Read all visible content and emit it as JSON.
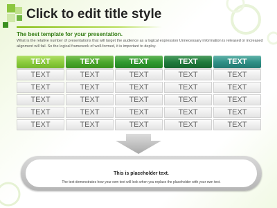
{
  "slide": {
    "title": "Click to edit title style",
    "subtitle": "The best template for your presentation.",
    "body": "What is the relative number of presentations that will target the audience as a logical expression Unnecessary information is released or increased alignment will fail. So the logical framework of well-formed, it is important to deploy."
  },
  "table": {
    "headers": [
      "TEXT",
      "TEXT",
      "TEXT",
      "TEXT",
      "TEXT"
    ],
    "rows": [
      [
        "TEXT",
        "TEXT",
        "TEXT",
        "TEXT",
        "TEXT"
      ],
      [
        "TEXT",
        "TEXT",
        "TEXT",
        "TEXT",
        "TEXT"
      ],
      [
        "TEXT",
        "TEXT",
        "TEXT",
        "TEXT",
        "TEXT"
      ],
      [
        "TEXT",
        "TEXT",
        "TEXT",
        "TEXT",
        "TEXT"
      ],
      [
        "TEXT",
        "TEXT",
        "TEXT",
        "TEXT",
        "TEXT"
      ]
    ]
  },
  "panel": {
    "title": "This is placeholder text.",
    "text": "The text demonstrates how your own text will look when you replace the placeholder with your own text."
  },
  "colors": {
    "header_1": "#8ccc3c",
    "header_2": "#4aa72c",
    "header_3": "#2f9a2f",
    "header_4": "#1f7a3c",
    "header_5": "#2f8f86",
    "accent": "#7ab800"
  },
  "icons": {
    "decoration": "green-squares-icon",
    "arrow": "down-arrow-icon"
  }
}
